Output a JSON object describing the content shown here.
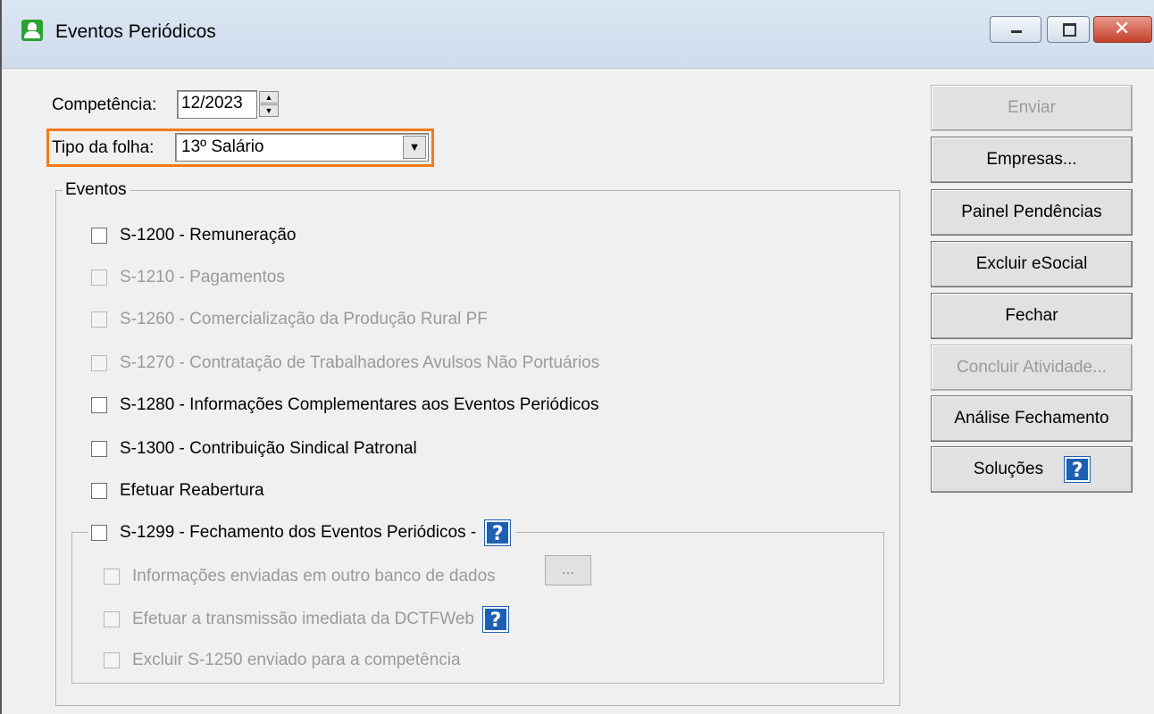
{
  "window": {
    "title": "Eventos Periódicos",
    "controls": {
      "minimize": "▁",
      "maximize": "▢",
      "close": "✕"
    }
  },
  "form": {
    "competencia_label": "Competência:",
    "competencia_value": "12/2023",
    "tipo_folha_label": "Tipo da folha:",
    "tipo_folha_value": "13º Salário"
  },
  "eventos": {
    "caption": "Eventos",
    "items": [
      {
        "label": "S-1200 - Remuneração",
        "enabled": true,
        "checked": false
      },
      {
        "label": "S-1210 - Pagamentos",
        "enabled": false,
        "checked": false
      },
      {
        "label": "S-1260 - Comercialização da Produção Rural PF",
        "enabled": false,
        "checked": false
      },
      {
        "label": "S-1270 - Contratação de Trabalhadores Avulsos Não Portuários",
        "enabled": false,
        "checked": false
      },
      {
        "label": "S-1280 - Informações Complementares aos Eventos Periódicos",
        "enabled": true,
        "checked": false
      },
      {
        "label": "S-1300 - Contribuição Sindical Patronal",
        "enabled": true,
        "checked": false
      },
      {
        "label": "Efetuar Reabertura",
        "enabled": true,
        "checked": false
      }
    ],
    "fechamento": {
      "label": "S-1299 - Fechamento dos Eventos Periódicos -",
      "sub_items": [
        {
          "label": "Informações enviadas em outro banco de dados",
          "enabled": false
        },
        {
          "label": "Efetuar a transmissão imediata da DCTFWeb",
          "enabled": false
        },
        {
          "label": "Excluir S-1250 enviado para a competência",
          "enabled": false
        }
      ],
      "ellipsis_label": "..."
    }
  },
  "help_glyph": "?",
  "buttons": [
    {
      "label": "Enviar",
      "enabled": false
    },
    {
      "label": "Empresas...",
      "enabled": true
    },
    {
      "label": "Painel Pendências",
      "enabled": true
    },
    {
      "label": "Excluir eSocial",
      "enabled": true
    },
    {
      "label": "Fechar",
      "enabled": true
    },
    {
      "label": "Concluir Atividade...",
      "enabled": false
    },
    {
      "label": "Análise Fechamento",
      "enabled": true
    },
    {
      "label": "Soluções",
      "enabled": true
    }
  ],
  "colors": {
    "highlight": "#f07b1c",
    "help_blue": "#1d5fb3",
    "app_icon": "#2aa332"
  }
}
